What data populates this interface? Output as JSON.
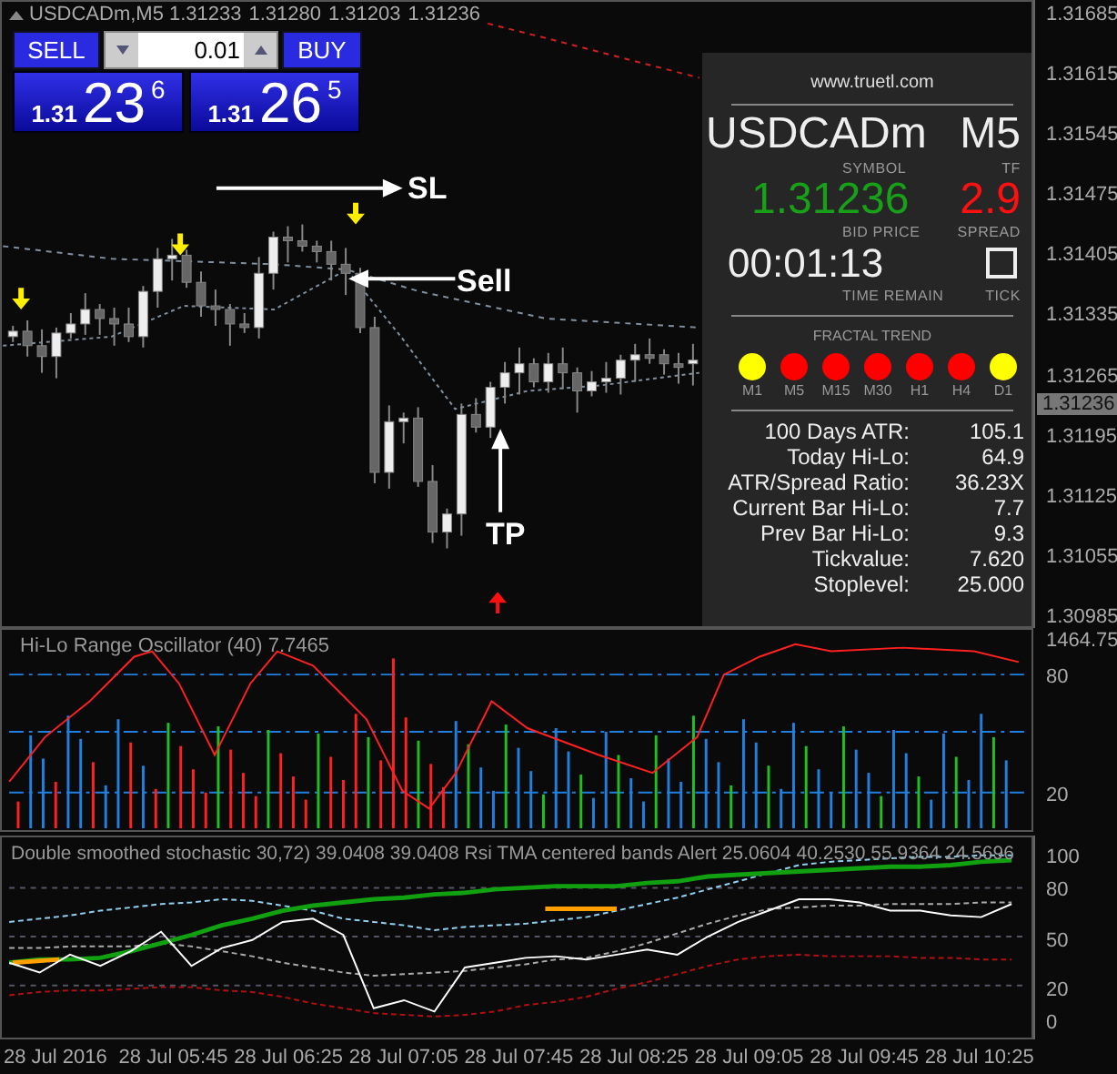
{
  "chart_header": {
    "symbol": "USDCADm,M5",
    "quotes": [
      "1.31233",
      "1.31280",
      "1.31203",
      "1.31236"
    ]
  },
  "trade_panel": {
    "sell_label": "SELL",
    "buy_label": "BUY",
    "lot": "0.01",
    "prices": [
      {
        "prefix": "1.31",
        "big": "23",
        "pips": "6"
      },
      {
        "prefix": "1.31",
        "big": "26",
        "pips": "5"
      }
    ]
  },
  "annotations": [
    {
      "kind": "sl",
      "text": "SL"
    },
    {
      "kind": "sell",
      "text": "Sell"
    },
    {
      "kind": "tp",
      "text": "TP"
    }
  ],
  "info_panel": {
    "site": "www.truetl.com",
    "symbol": "USDCADm",
    "symbol_label": "SYMBOL",
    "tf": "M5",
    "tf_label": "TF",
    "bid": "1.31236",
    "bid_label": "BID PRICE",
    "spread": "2.9",
    "spread_label": "SPREAD",
    "time": "00:01:13",
    "time_label": "TIME REMAIN",
    "tick_label": "TICK",
    "tick_checked": false,
    "trend_title": "FRACTAL TREND",
    "trend": [
      {
        "label": "M1",
        "color": "#ffff00"
      },
      {
        "label": "M5",
        "color": "#ff0000"
      },
      {
        "label": "M15",
        "color": "#ff0000"
      },
      {
        "label": "M30",
        "color": "#ff0000"
      },
      {
        "label": "H1",
        "color": "#ff0000"
      },
      {
        "label": "H4",
        "color": "#ff0000"
      },
      {
        "label": "D1",
        "color": "#ffff00"
      }
    ],
    "stats": [
      {
        "label": "100 Days ATR:",
        "value": "105.1"
      },
      {
        "label": "Today Hi-Lo:",
        "value": "64.9"
      },
      {
        "label": "ATR/Spread Ratio:",
        "value": "36.23X"
      },
      {
        "label": "Current Bar Hi-Lo:",
        "value": "7.7"
      },
      {
        "label": "Prev Bar Hi-Lo:",
        "value": "9.3"
      },
      {
        "label": "Tickvalue:",
        "value": "7.620"
      },
      {
        "label": "Stoplevel:",
        "value": "25.000"
      }
    ]
  },
  "price_axis": {
    "ticks": [
      "1.31685",
      "1.31615",
      "1.31545",
      "1.31475",
      "1.31405",
      "1.31335",
      "1.31265",
      "1.31195",
      "1.31125",
      "1.31055",
      "1.30985"
    ],
    "current": "1.31236"
  },
  "oscillator": {
    "title": "Hi-Lo Range Oscillator (40) 7.7465",
    "axis": [
      "1464.75",
      "80",
      "20"
    ]
  },
  "stochastic": {
    "title": "Double smoothed stochastic 30,72) 39.0408 39.0408  Rsi TMA centered bands Alert 25.0604 40.2530 55.9364 24.5696",
    "chart_data": {
      "type": "line",
      "ylim": [
        -12,
        111
      ],
      "yticks": [
        0,
        20,
        50,
        80,
        100
      ],
      "grid": true,
      "series": [
        {
          "color": "#ffffff",
          "values": [
            34,
            28,
            39,
            32,
            41,
            53,
            32,
            43,
            48,
            59,
            61,
            51,
            6,
            11,
            4,
            31,
            34,
            37,
            38,
            36,
            39,
            42,
            39,
            50,
            59,
            66,
            73,
            73,
            71,
            66,
            66,
            63,
            62,
            70
          ]
        },
        {
          "color": "#10a010",
          "values": [
            34,
            36,
            36,
            37,
            41,
            46,
            51,
            57,
            61,
            66,
            69,
            71,
            73,
            74,
            76,
            77,
            79,
            80,
            81,
            81,
            81,
            83,
            84,
            87,
            88,
            89,
            90,
            91,
            92,
            93,
            93,
            94,
            96,
            97
          ]
        },
        {
          "color": "#90d0f0",
          "line_style": "dashed",
          "values": [
            59,
            61,
            63,
            66,
            68,
            70,
            71,
            73,
            72,
            69,
            66,
            61,
            59,
            57,
            54,
            56,
            57,
            58,
            60,
            62,
            66,
            70,
            74,
            79,
            84,
            89,
            94,
            96,
            97,
            98,
            99,
            99,
            100,
            100
          ]
        },
        {
          "color": "#aaaaaa",
          "line_style": "dashed",
          "values": [
            43,
            43,
            44,
            44,
            44,
            46,
            44,
            41,
            38,
            34,
            31,
            28,
            26,
            27,
            28,
            29,
            31,
            33,
            36,
            37,
            41,
            46,
            52,
            58,
            63,
            67,
            68,
            69,
            69,
            70,
            70,
            70,
            71,
            71
          ]
        },
        {
          "color": "#b01010",
          "line_style": "dashed",
          "values": [
            14,
            16,
            17,
            17,
            18,
            19,
            19,
            17,
            16,
            13,
            9,
            6,
            3,
            2,
            1,
            2,
            4,
            8,
            10,
            13,
            18,
            22,
            27,
            32,
            36,
            38,
            39,
            38,
            38,
            38,
            37,
            37,
            36,
            36
          ]
        }
      ]
    }
  },
  "time_axis": [
    "28 Jul 2016",
    "28 Jul 05:45",
    "28 Jul 06:25",
    "28 Jul 07:05",
    "28 Jul 07:45",
    "28 Jul 08:25",
    "28 Jul 09:05",
    "28 Jul 09:45",
    "28 Jul 10:25"
  ]
}
